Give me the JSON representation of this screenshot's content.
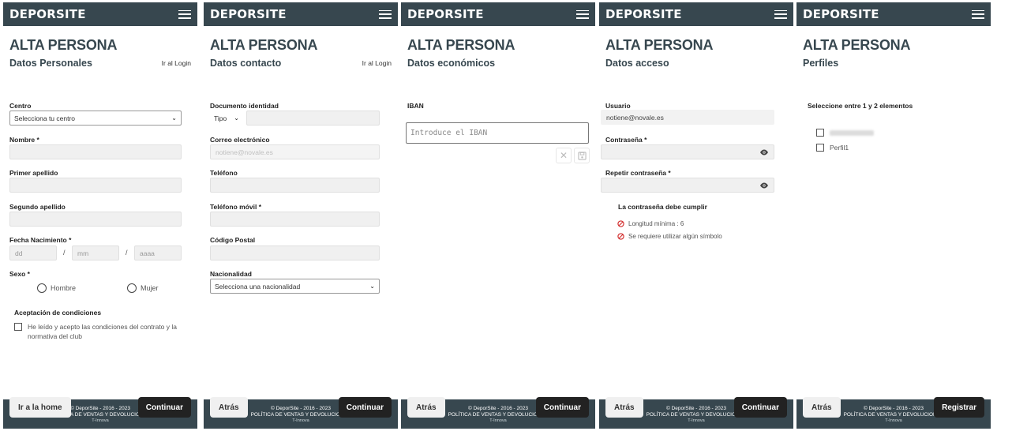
{
  "brand": "DEPORSITE",
  "page_title": "ALTA PERSONA",
  "login_link": "Ir al Login",
  "footer": {
    "copyright": "© DeporSite - 2016 - 2023",
    "policy": "POLÍTICA DE VENTAS Y DEVOLUCIONES",
    "credit": "T-Innova"
  },
  "step1": {
    "section": "Datos Personales",
    "centro_label": "Centro",
    "centro_value": "Selecciona tu centro",
    "nombre_label": "Nombre *",
    "apellido1_label": "Primer apellido",
    "apellido2_label": "Segundo apellido",
    "fecha_label": "Fecha Nacimiento *",
    "dd": "dd",
    "mm": "mm",
    "aaaa": "aaaa",
    "slash": "/",
    "sexo_label": "Sexo *",
    "hombre": "Hombre",
    "mujer": "Mujer",
    "condiciones_title": "Aceptación de condiciones",
    "condiciones_text": "He leído y acepto las condiciones del contrato y la normativa del club",
    "back_button": "Ir a la home",
    "next_button": "Continuar"
  },
  "step2": {
    "section": "Datos contacto",
    "documento_label": "Documento identidad",
    "tipo_value": "Tipo",
    "correo_label": "Correo electrónico",
    "correo_value": "notiene@novale.es",
    "telefono_label": "Teléfono",
    "movil_label": "Teléfono móvil *",
    "cp_label": "Código Postal",
    "nacionalidad_label": "Nacionalidad",
    "nacionalidad_value": "Selecciona una nacionalidad",
    "back_button": "Atrás",
    "next_button": "Continuar"
  },
  "step3": {
    "section": "Datos económicos",
    "iban_label": "IBAN",
    "iban_placeholder": "Introduce el IBAN",
    "back_button": "Atrás",
    "next_button": "Continuar"
  },
  "step4": {
    "section": "Datos acceso",
    "usuario_label": "Usuario",
    "usuario_value": "notiene@novale.es",
    "password_label": "Contraseña *",
    "repeat_label": "Repetir contraseña *",
    "rules_title": "La contraseña debe cumplir",
    "rule1": "Longitud mínima :  6",
    "rule2": "Se requiere utilizar algún símbolo",
    "back_button": "Atrás",
    "next_button": "Continuar"
  },
  "step5": {
    "section": "Perfiles",
    "instruction": "Seleccione entre 1 y 2 elementos",
    "profile1": "Trabajador Galeria",
    "profile2": "Perfil1",
    "back_button": "Atrás",
    "next_button": "Registrar"
  }
}
